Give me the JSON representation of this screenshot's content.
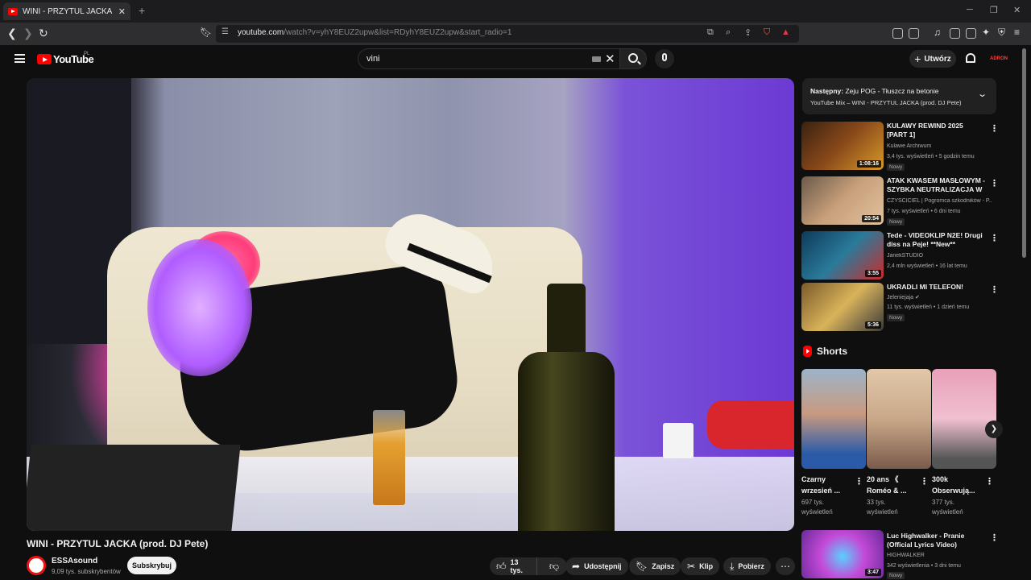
{
  "browser": {
    "tab_title": "WINI - PRZYTUL JACKA (prod. D",
    "url_domain": "youtube.com",
    "url_path": "/watch?v=yhY8EUZ2upw&list=RDyhY8EUZ2upw&start_radio=1",
    "icons": [
      "back-icon",
      "forward-icon",
      "reload-icon",
      "bookmark-icon",
      "site-settings-icon",
      "open-in-app-icon",
      "zoom-icon",
      "share-icon",
      "brave-shield-icon",
      "rewards-icon",
      "extensions-icon",
      "sidebar-icon",
      "wallet-icon",
      "vpn-icon",
      "menu-icon"
    ]
  },
  "header": {
    "logo_text": "YouTube",
    "country": "PL",
    "search_value": "vini",
    "create_label": "Utwórz",
    "avatar_text": "ADRON"
  },
  "video": {
    "title": "WINI - PRZYTUL JACKA (prod. DJ Pete)",
    "channel": "ESSAsound",
    "subscribers": "9,09 tys. subskrybentów",
    "subscribe_label": "Subskrybuj",
    "likes": "13 tys.",
    "share_label": "Udostępnij",
    "save_label": "Zapisz",
    "clip_label": "Klip",
    "download_label": "Pobierz"
  },
  "sidebar": {
    "next_prefix": "Następny:",
    "next_title": "Zeju POG - Tłuszcz na betonie",
    "next_sub": "YouTube Mix – WINI - PRZYTUL JACKA (prod. DJ Pete)",
    "recs": [
      {
        "title": "KULAWY REWIND 2025 [PART 1]",
        "channel": "Kulawe Archiwum",
        "meta": "3,4 tys. wyświetleń • 5 godzin temu",
        "badge": "Nowy",
        "duration": "1:08:16",
        "thumb_color": "#6a3a1a"
      },
      {
        "title": "ATAK KWASEM MASŁOWYM - SZYBKA NEUTRALIZACJA W ...",
        "channel": "CZYŚCICIEL | Pogromca szkodników - P...",
        "meta": "7 tys. wyświetleń • 6 dni temu",
        "badge": "Nowy",
        "duration": "20:54",
        "thumb_color": "#b58a6a"
      },
      {
        "title": "Tede - VIDEOKLIP N2E! Drugi diss na Peje! **New**",
        "channel": "JanekSTUDIO",
        "meta": "2,4 mln wyświetleń • 16 lat temu",
        "badge": "",
        "duration": "3:55",
        "thumb_color": "#2a6a8a"
      },
      {
        "title": "UKRADLI MI TELEFON!",
        "channel": "Jeleniejaja",
        "meta": "11 tys. wyświetleń • 1 dzień temu",
        "badge": "Nowy",
        "duration": "5:36",
        "thumb_color": "#c9a24a"
      }
    ],
    "shorts_label": "Shorts",
    "shorts": [
      {
        "title": "Czarny wrzesień ...",
        "views": "697 tys. wyświetleń",
        "thumb_color": "#7b9bb8"
      },
      {
        "title": "20 ans 《 Roméo & ...",
        "views": "33 tys. wyświetleń",
        "thumb_color": "#c9a88a"
      },
      {
        "title": "300k Obserwują...",
        "views": "377 tys. wyświetleń",
        "thumb_color": "#d98aa8"
      }
    ],
    "last_rec": {
      "title": "Luc Highwalker - Pranie (Official Lyrics Video)",
      "channel": "HIGHWALKER",
      "meta": "342 wyświetlenia • 3 dni temu",
      "badge": "Nowy",
      "duration": "3:47",
      "thumb_color": "#c44ad8"
    }
  }
}
